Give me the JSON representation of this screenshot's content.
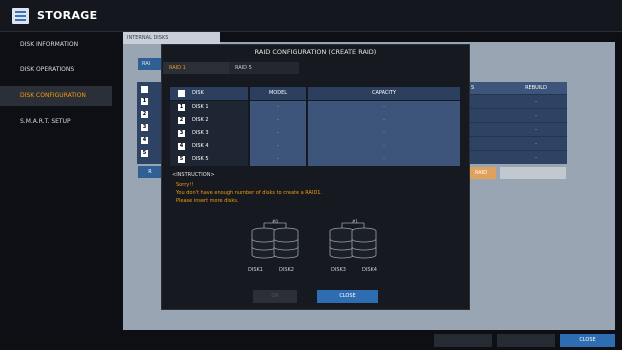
{
  "app": {
    "title": "STORAGE"
  },
  "sidebar": {
    "items": [
      {
        "label": "DISK INFORMATION"
      },
      {
        "label": "DISK OPERATIONS"
      },
      {
        "label": "DISK CONFIGURATION"
      },
      {
        "label": "S.M.A.R.T. SETUP"
      }
    ]
  },
  "main": {
    "tab_internal": "INTERNAL DISKS",
    "raid_button": "RAI",
    "col_s": "S",
    "col_rebuild": "REBUILD",
    "rebuild_values": [
      "-",
      "-",
      "-",
      "-",
      "-"
    ],
    "left_nums": [
      "",
      "1",
      "2",
      "3",
      "4",
      "5"
    ],
    "raid_action": "RAID",
    "r_button": "R"
  },
  "modal": {
    "title": "RAID CONFIGURATION (CREATE RAID)",
    "tabs": [
      "RAID 1",
      "RAID 5"
    ],
    "headers": {
      "disk": "DISK",
      "model": "MODEL",
      "capacity": "CAPACITY"
    },
    "rows": [
      {
        "num": "1",
        "disk": "DISK 1",
        "model": "-",
        "capacity": "-"
      },
      {
        "num": "2",
        "disk": "DISK 2",
        "model": "-",
        "capacity": "-"
      },
      {
        "num": "3",
        "disk": "DISK 3",
        "model": "-",
        "capacity": "-"
      },
      {
        "num": "4",
        "disk": "DISK 4",
        "model": "-",
        "capacity": "-"
      },
      {
        "num": "5",
        "disk": "DISK 5",
        "model": "-",
        "capacity": "-"
      }
    ],
    "instruction_title": "<INSTRUCTION>",
    "warning_lines": [
      "Sorry!!",
      "You don't have enough number of disks to create a RAID1.",
      "Please insert more disks."
    ],
    "diagram": {
      "group_labels": [
        "#0",
        "#1"
      ],
      "disk_labels": [
        "DISK1",
        "DISK2",
        "DISK3",
        "DISK4"
      ]
    },
    "ok_label": "OK",
    "close_label": "CLOSE"
  },
  "footer": {
    "close_label": "CLOSE"
  }
}
